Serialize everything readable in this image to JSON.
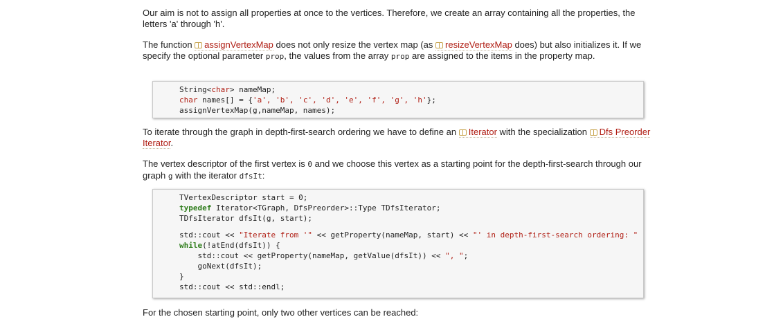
{
  "para1": "Our aim is not to assign all properties at once to the vertices. Therefore, we create an array containing all the properties, the letters 'a' through 'h'.",
  "para2": {
    "t1": "The function ",
    "link1": "assignVertexMap",
    "t2": " does not only resize the vertex map (as ",
    "link2": "resizeVertexMap",
    "t3": " does) but also initializes it. If we specify the optional parameter ",
    "code1": "prop",
    "t4": ", the values from the array ",
    "code2": "prop",
    "t5": " are assigned to the items in the property map."
  },
  "code1": {
    "l1a": "String<",
    "l1kw": "char",
    "l1b": "> nameMap;",
    "l2kw": "char",
    "l2a": " names[] = {",
    "l2str": "'a', 'b', 'c', 'd', 'e', 'f', 'g', 'h'",
    "l2b": "};",
    "l3": "assignVertexMap(g,nameMap, names);"
  },
  "para3": {
    "t1": "To iterate through the graph in depth-first-search ordering we have to define an ",
    "link1": "Iterator",
    "t2": " with the specialization ",
    "link2": "Dfs Preorder Iterator",
    "t3": "."
  },
  "para4": {
    "t1": "The vertex descriptor of the first vertex is ",
    "code1": "0",
    "t2": " and we choose this vertex as a starting point for the depth-first-search through our graph ",
    "code2": "g",
    "t3": " with the iterator ",
    "code3": "dfsIt",
    "t4": ":"
  },
  "code2": {
    "l1": "TVertexDescriptor start = 0;",
    "l2kw": "typedef",
    "l2": " Iterator<TGraph, DfsPreorder>::Type TDfsIterator;",
    "l3": "TDfsIterator dfsIt(g, start);",
    "l4a": "std::cout << ",
    "l4str": "\"Iterate from '\"",
    "l4b": " << getProperty(nameMap, start) << ",
    "l4str2": "\"' in depth-first-search ordering: \"",
    "l5kw": "while",
    "l5": "(!atEnd(dfsIt)) {",
    "l6a": "    std::cout << getProperty(nameMap, getValue(dfsIt)) << ",
    "l6str": "\", \"",
    "l6b": ";",
    "l7": "    goNext(dfsIt);",
    "l8": "}",
    "l9": "std::cout << std::endl;"
  },
  "para5": "For the chosen starting point, only two other vertices can be reached:"
}
